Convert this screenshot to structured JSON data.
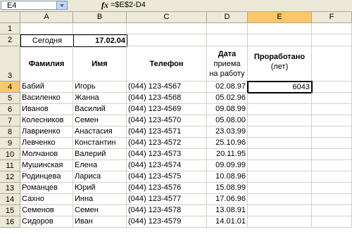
{
  "formula_bar": {
    "name_box": "E4",
    "fx_icon": "fx-icon",
    "formula": "=$E$2-D4"
  },
  "columns": [
    "A",
    "B",
    "C",
    "D",
    "E",
    "F"
  ],
  "rows": [
    "1",
    "2",
    "3",
    "4",
    "5",
    "6",
    "7",
    "8",
    "9",
    "10",
    "11",
    "12",
    "13",
    "14",
    "15",
    "16"
  ],
  "cells": {
    "a2": "Сегодня",
    "b2": "17.02.04",
    "a3": "Фамилия",
    "b3": "Имя",
    "c3": "Телефон",
    "d3_line1": "Дата",
    "d3_line2": "приема",
    "d3_line3": "на работу",
    "e3_line1": "Проработано",
    "e3_line2": "(лет)",
    "e4": "6043"
  },
  "employees": [
    {
      "last": "Бабий",
      "first": "Игорь",
      "phone": "(044) 123-4567",
      "date": "02.08.97"
    },
    {
      "last": "Василенко",
      "first": "Жанна",
      "phone": "(044) 123-4568",
      "date": "05.02.96"
    },
    {
      "last": "Иванов",
      "first": "Василий",
      "phone": "(044) 123-4569",
      "date": "09.08.99"
    },
    {
      "last": "Колесников",
      "first": "Семен",
      "phone": "(044) 123-4570",
      "date": "05.08.00"
    },
    {
      "last": "Лавриенко",
      "first": "Анастасия",
      "phone": "(044) 123-4571",
      "date": "23.03.99"
    },
    {
      "last": "Левченко",
      "first": "Константин",
      "phone": "(044) 123-4572",
      "date": "25.10.96"
    },
    {
      "last": "Молчанов",
      "first": "Валерий",
      "phone": "(044) 123-4573",
      "date": "20.11.95"
    },
    {
      "last": "Мушинская",
      "first": "Елена",
      "phone": "(044) 123-4574",
      "date": "09.09.99"
    },
    {
      "last": "Родинцева",
      "first": "Лариса",
      "phone": "(044) 123-4575",
      "date": "10.08.96"
    },
    {
      "last": "Романцев",
      "first": "Юрий",
      "phone": "(044) 123-4576",
      "date": "15.08.99"
    },
    {
      "last": "Сахно",
      "first": "Инна",
      "phone": "(044) 123-4577",
      "date": "17.06.96"
    },
    {
      "last": "Семенов",
      "first": "Семен",
      "phone": "(044) 123-4578",
      "date": "13.08.91"
    },
    {
      "last": "Сидоров",
      "first": "Иван",
      "phone": "(044) 123-4579",
      "date": "14.01.01"
    }
  ],
  "colors": {
    "header_bg": "#ece9d8",
    "active_header": "#ffc66a",
    "gridline": "#d4d0c8"
  }
}
